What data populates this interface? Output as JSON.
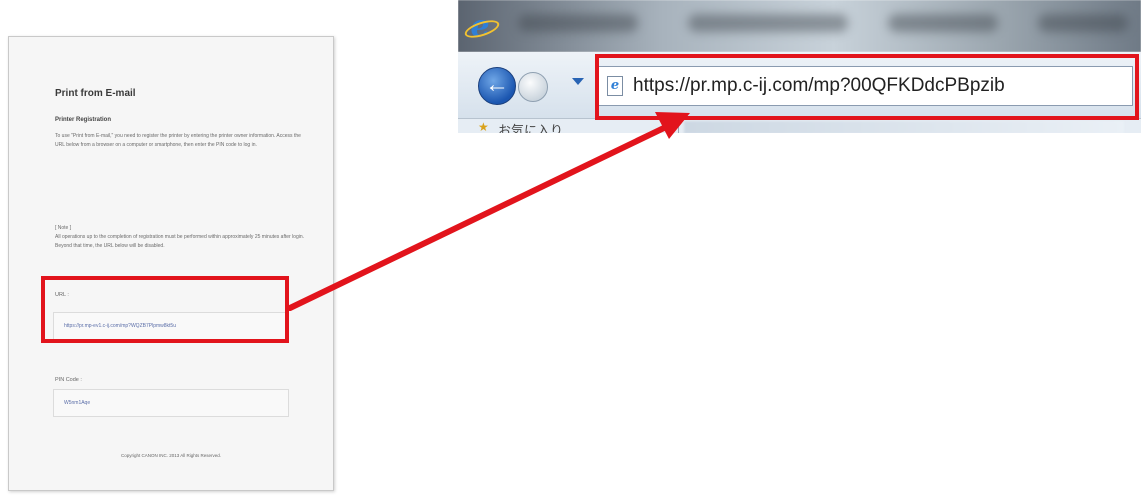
{
  "sheet": {
    "title": "Print from E-mail",
    "subhead": "Printer Registration",
    "paragraph1": "To use \"Print from E-mail,\" you need to register the printer by entering the printer owner information. Access the URL below from a browser on a computer or smartphone, then enter the PIN code to log in.",
    "note_label": "[ Note ]",
    "paragraph2": "All operations up to the completion of registration must be performed within approximately 25 minutes after login. Beyond that time, the URL below will be disabled.",
    "url_label": "URL :",
    "url_value": "https://pr.mp-ev1.c-ij.com/mp?WQZB7Plpmw8kt5u",
    "pin_label": "PIN Code :",
    "pin_value": "W5nm1Aqe",
    "copyright": "Copyright CANON INC. 2013 All Rights Reserved."
  },
  "browser": {
    "address_url": "https://pr.mp.c-ij.com/mp?00QFKDdcPBpzib",
    "favorites_label": "お気に入り",
    "ie_logo_glyph": "e",
    "page_icon_glyph": "e",
    "back_glyph": "←",
    "star_glyph": "★"
  },
  "annotations": {
    "highlight_color": "#e2141c"
  }
}
